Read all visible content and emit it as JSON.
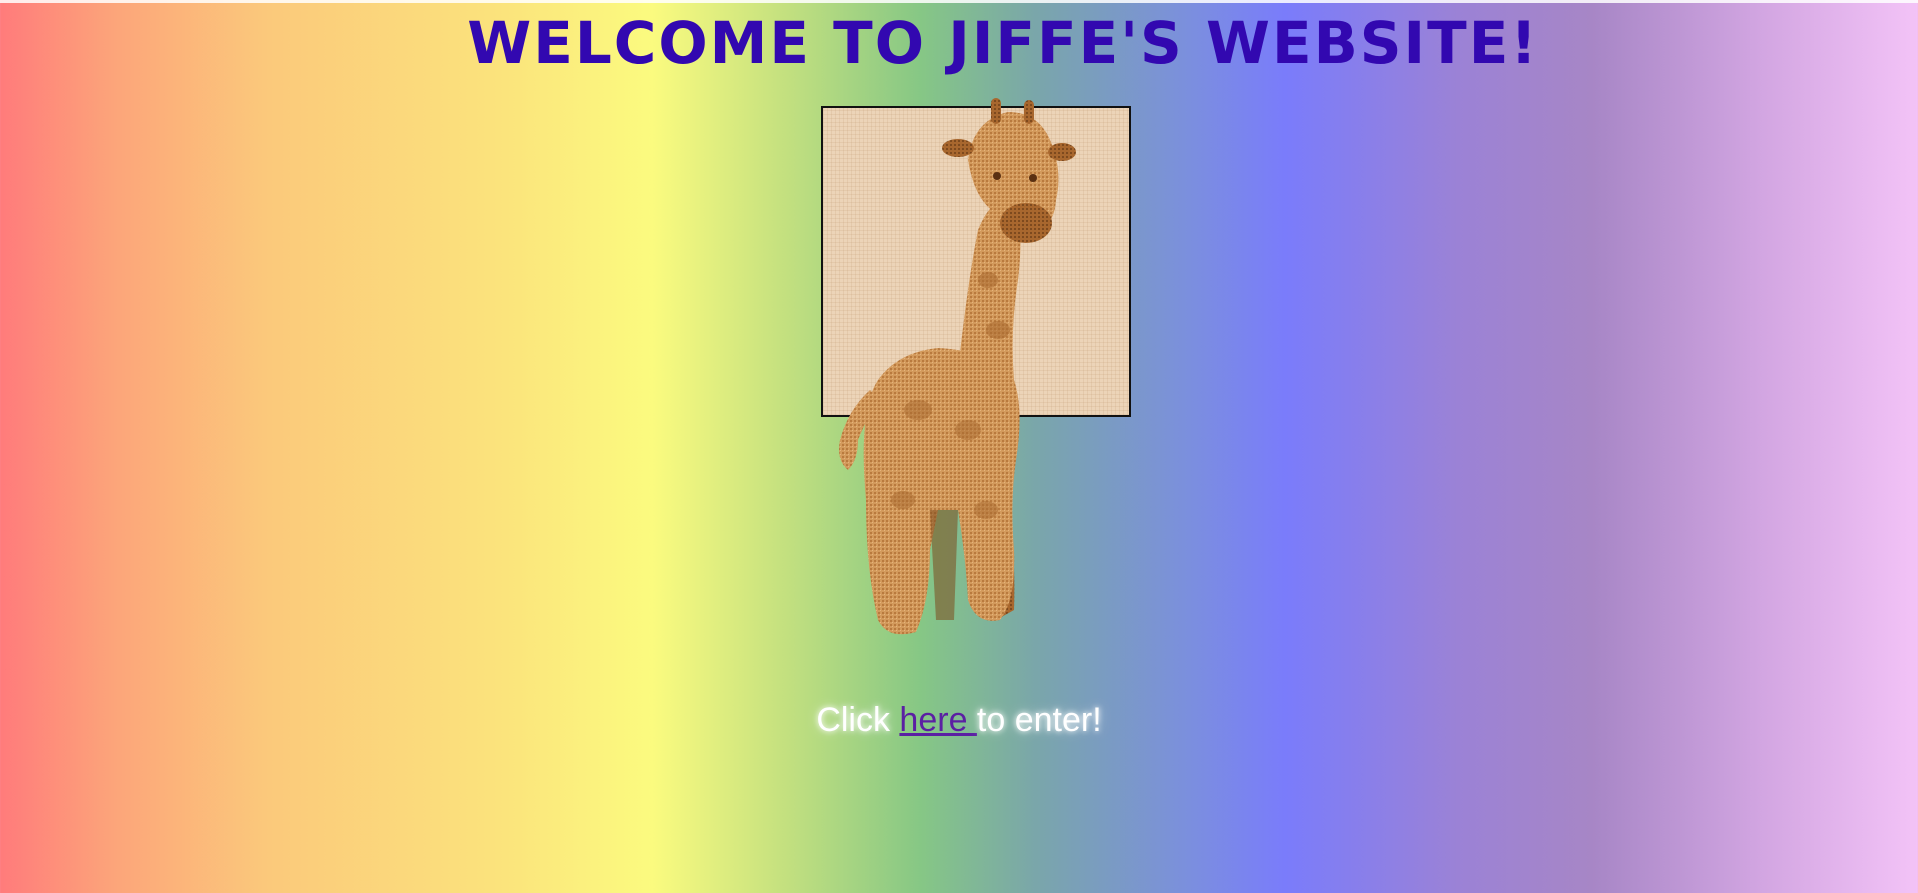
{
  "page": {
    "title": "WELCOME TO JIFFE'S WEBSITE!",
    "image_alt": "stuffed giraffe toy",
    "enter": {
      "prefix": "Click ",
      "link_text": "here ",
      "suffix": "to enter!"
    }
  },
  "colors": {
    "title": "#3208b0",
    "link": "#5b1fa3",
    "frame_border": "#111111"
  }
}
